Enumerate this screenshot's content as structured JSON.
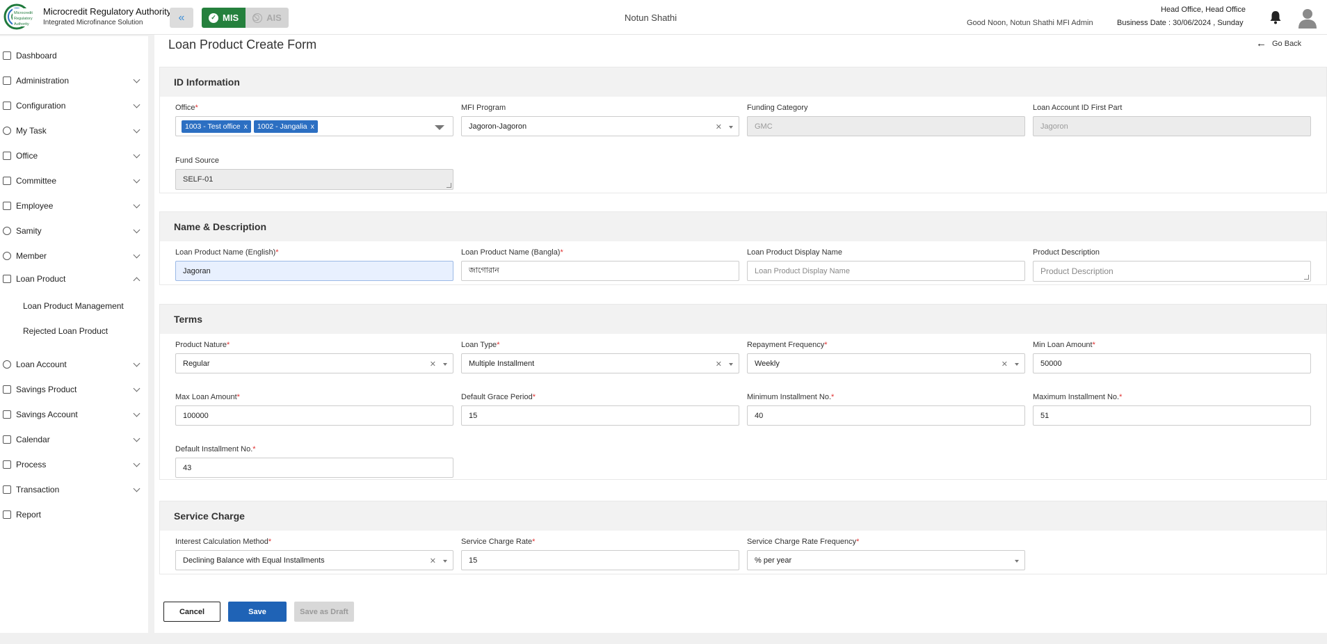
{
  "header": {
    "brand_title": "Microcredit Regulatory Authority",
    "brand_sub": "Integrated Microfinance Solution",
    "logo_text": "Microcredit Regulatory Authority",
    "mis_label": "MIS",
    "ais_label": "AIS",
    "center_title": "Notun Shathi",
    "greeting": "Good Noon, Notun Shathi MFI Admin",
    "office": "Head Office, Head Office",
    "business_date": "Business Date : 30/06/2024 , Sunday",
    "colors": {
      "mis": "#25803d",
      "accent": "#1f63b6"
    }
  },
  "sidebar": {
    "items": [
      {
        "label": "Dashboard",
        "icon": "grid-icon",
        "chevron": false
      },
      {
        "label": "Administration",
        "icon": "users-icon",
        "chevron": true
      },
      {
        "label": "Configuration",
        "icon": "sliders-icon",
        "chevron": true
      },
      {
        "label": "My Task",
        "icon": "task-icon",
        "chevron": true
      },
      {
        "label": "Office",
        "icon": "building-icon",
        "chevron": true
      },
      {
        "label": "Committee",
        "icon": "committee-icon",
        "chevron": true
      },
      {
        "label": "Employee",
        "icon": "employee-icon",
        "chevron": true
      },
      {
        "label": "Samity",
        "icon": "samity-icon",
        "chevron": true
      },
      {
        "label": "Member",
        "icon": "member-icon",
        "chevron": true
      },
      {
        "label": "Loan Product",
        "icon": "loan-product-icon",
        "chevron": true,
        "expanded": true
      },
      {
        "label": "Loan Account",
        "icon": "loan-account-icon",
        "chevron": true
      },
      {
        "label": "Savings Product",
        "icon": "savings-product-icon",
        "chevron": true
      },
      {
        "label": "Savings Account",
        "icon": "savings-account-icon",
        "chevron": true
      },
      {
        "label": "Calendar",
        "icon": "calendar-icon",
        "chevron": true
      },
      {
        "label": "Process",
        "icon": "process-icon",
        "chevron": true
      },
      {
        "label": "Transaction",
        "icon": "transaction-icon",
        "chevron": true
      },
      {
        "label": "Report",
        "icon": "report-icon",
        "chevron": false
      }
    ],
    "sub_items": [
      "Loan Product Management",
      "Rejected Loan Product"
    ]
  },
  "page": {
    "title": "Loan Product Create Form",
    "go_back": "Go Back"
  },
  "id_info": {
    "title": "ID Information",
    "office": {
      "label": "Office",
      "chips": [
        "1003 - Test office",
        "1002 - Jangalia"
      ],
      "chip_remove": "x"
    },
    "mfi_program": {
      "label": "MFI Program",
      "value": "Jagoron-Jagoron"
    },
    "funding_category": {
      "label": "Funding Category",
      "value": "GMC"
    },
    "loan_account_id": {
      "label": "Loan Account ID First Part",
      "value": "Jagoron"
    },
    "fund_source": {
      "label": "Fund Source",
      "value": "SELF-01"
    }
  },
  "name_desc": {
    "title": "Name & Description",
    "name_en": {
      "label": "Loan Product Name (English)",
      "value": "Jagoran"
    },
    "name_bn": {
      "label": "Loan Product Name (Bangla)",
      "value": "জাগোরান"
    },
    "display_name": {
      "label": "Loan Product Display Name",
      "placeholder": "Loan Product Display Name"
    },
    "description": {
      "label": "Product Description",
      "placeholder": "Product Description"
    }
  },
  "terms": {
    "title": "Terms",
    "product_nature": {
      "label": "Product Nature",
      "value": "Regular"
    },
    "loan_type": {
      "label": "Loan Type",
      "value": "Multiple Installment"
    },
    "repayment_frequency": {
      "label": "Repayment Frequency",
      "value": "Weekly"
    },
    "min_loan": {
      "label": "Min Loan Amount",
      "value": "50000"
    },
    "max_loan": {
      "label": "Max Loan Amount",
      "value": "100000"
    },
    "grace_period": {
      "label": "Default Grace Period",
      "value": "15"
    },
    "min_installment": {
      "label": "Minimum Installment No.",
      "value": "40"
    },
    "max_installment": {
      "label": "Maximum Installment No.",
      "value": "51"
    },
    "default_installment": {
      "label": "Default Installment No.",
      "value": "43"
    }
  },
  "service_charge": {
    "title": "Service Charge",
    "interest_method": {
      "label": "Interest Calculation Method",
      "value": "Declining Balance with Equal Installments"
    },
    "rate": {
      "label": "Service Charge Rate",
      "value": "15"
    },
    "rate_frequency": {
      "label": "Service Charge Rate Frequency",
      "value": "% per year"
    }
  },
  "actions": {
    "cancel": "Cancel",
    "save": "Save",
    "draft": "Save as Draft"
  }
}
